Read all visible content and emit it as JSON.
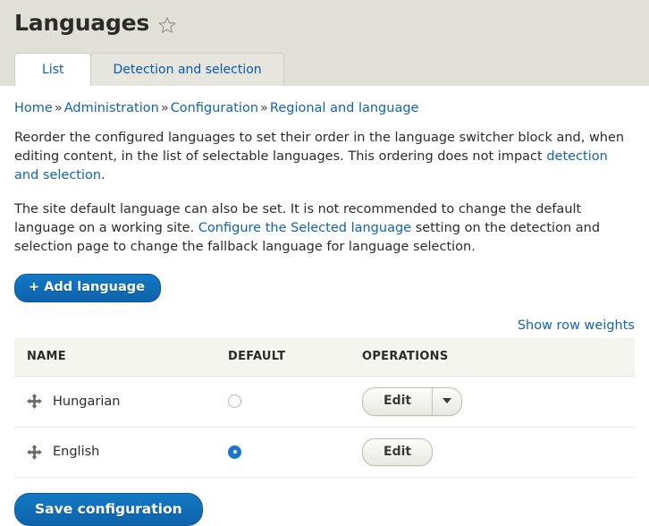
{
  "header": {
    "title": "Languages",
    "star_icon": "star-outline-icon"
  },
  "tabs": [
    {
      "label": "List",
      "active": true
    },
    {
      "label": "Detection and selection",
      "active": false
    }
  ],
  "breadcrumb": {
    "separator": "»",
    "items": [
      "Home",
      "Administration",
      "Configuration",
      "Regional and language"
    ]
  },
  "intro": {
    "paragraph1_part1": "Reorder the configured languages to set their order in the language switcher block and, when editing content, in the list of selectable languages. This ordering does not impact ",
    "paragraph1_link": "detection and selection",
    "paragraph1_part2": ".",
    "paragraph2_part1": "The site default language can also be set. It is not recommended to change the default language on a working site. ",
    "paragraph2_link": "Configure the Selected language",
    "paragraph2_part2": " setting on the detection and selection page to change the fallback language for language selection."
  },
  "actions": {
    "add_language": "+ Add language",
    "save_configuration": "Save configuration",
    "show_row_weights": "Show row weights"
  },
  "table": {
    "columns": [
      "NAME",
      "DEFAULT",
      "OPERATIONS"
    ],
    "rows": [
      {
        "name": "Hungarian",
        "is_default": false,
        "edit_label": "Edit",
        "has_dropdown": true,
        "drag_icon": "drag-move-icon"
      },
      {
        "name": "English",
        "is_default": true,
        "edit_label": "Edit",
        "has_dropdown": false,
        "drag_icon": "drag-move-icon"
      }
    ]
  },
  "colors": {
    "header_background": "#e0e0d8",
    "link": "#1162b4",
    "primary_button": "#0e63ab",
    "radio_selected": "#1878d0",
    "table_header_background": "#f5f5f0"
  }
}
